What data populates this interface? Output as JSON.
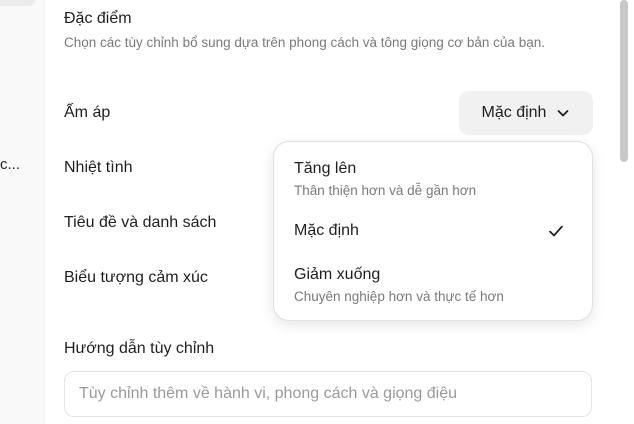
{
  "sidebar": {
    "truncated_item": "c..."
  },
  "section": {
    "title": "Đặc điểm",
    "description": "Chọn các tùy chỉnh bổ sung dựa trên phong cách và tông giọng cơ bản của bạn."
  },
  "settings": {
    "warmth_label": "Ấm áp",
    "enthusiasm_label": "Nhiệt tình",
    "headers_lists_label": "Tiêu đề và danh sách",
    "emoji_label": "Biểu tượng cảm xúc",
    "warmth_value": "Mặc định"
  },
  "dropdown": {
    "options": [
      {
        "title": "Tăng lên",
        "description": "Thân thiện hơn và dễ gần hơn",
        "selected": false
      },
      {
        "title": "Mặc định",
        "description": "",
        "selected": true
      },
      {
        "title": "Giảm xuống",
        "description": "Chuyên nghiệp hơn và thực tế hơn",
        "selected": false
      }
    ]
  },
  "custom_instructions": {
    "label": "Hướng dẫn tùy chỉnh",
    "value": "",
    "placeholder": "Tùy chỉnh thêm về hành vi, phong cách và giọng điệu"
  },
  "icons": {
    "chevron": "chevron-down-icon",
    "check": "check-icon"
  }
}
